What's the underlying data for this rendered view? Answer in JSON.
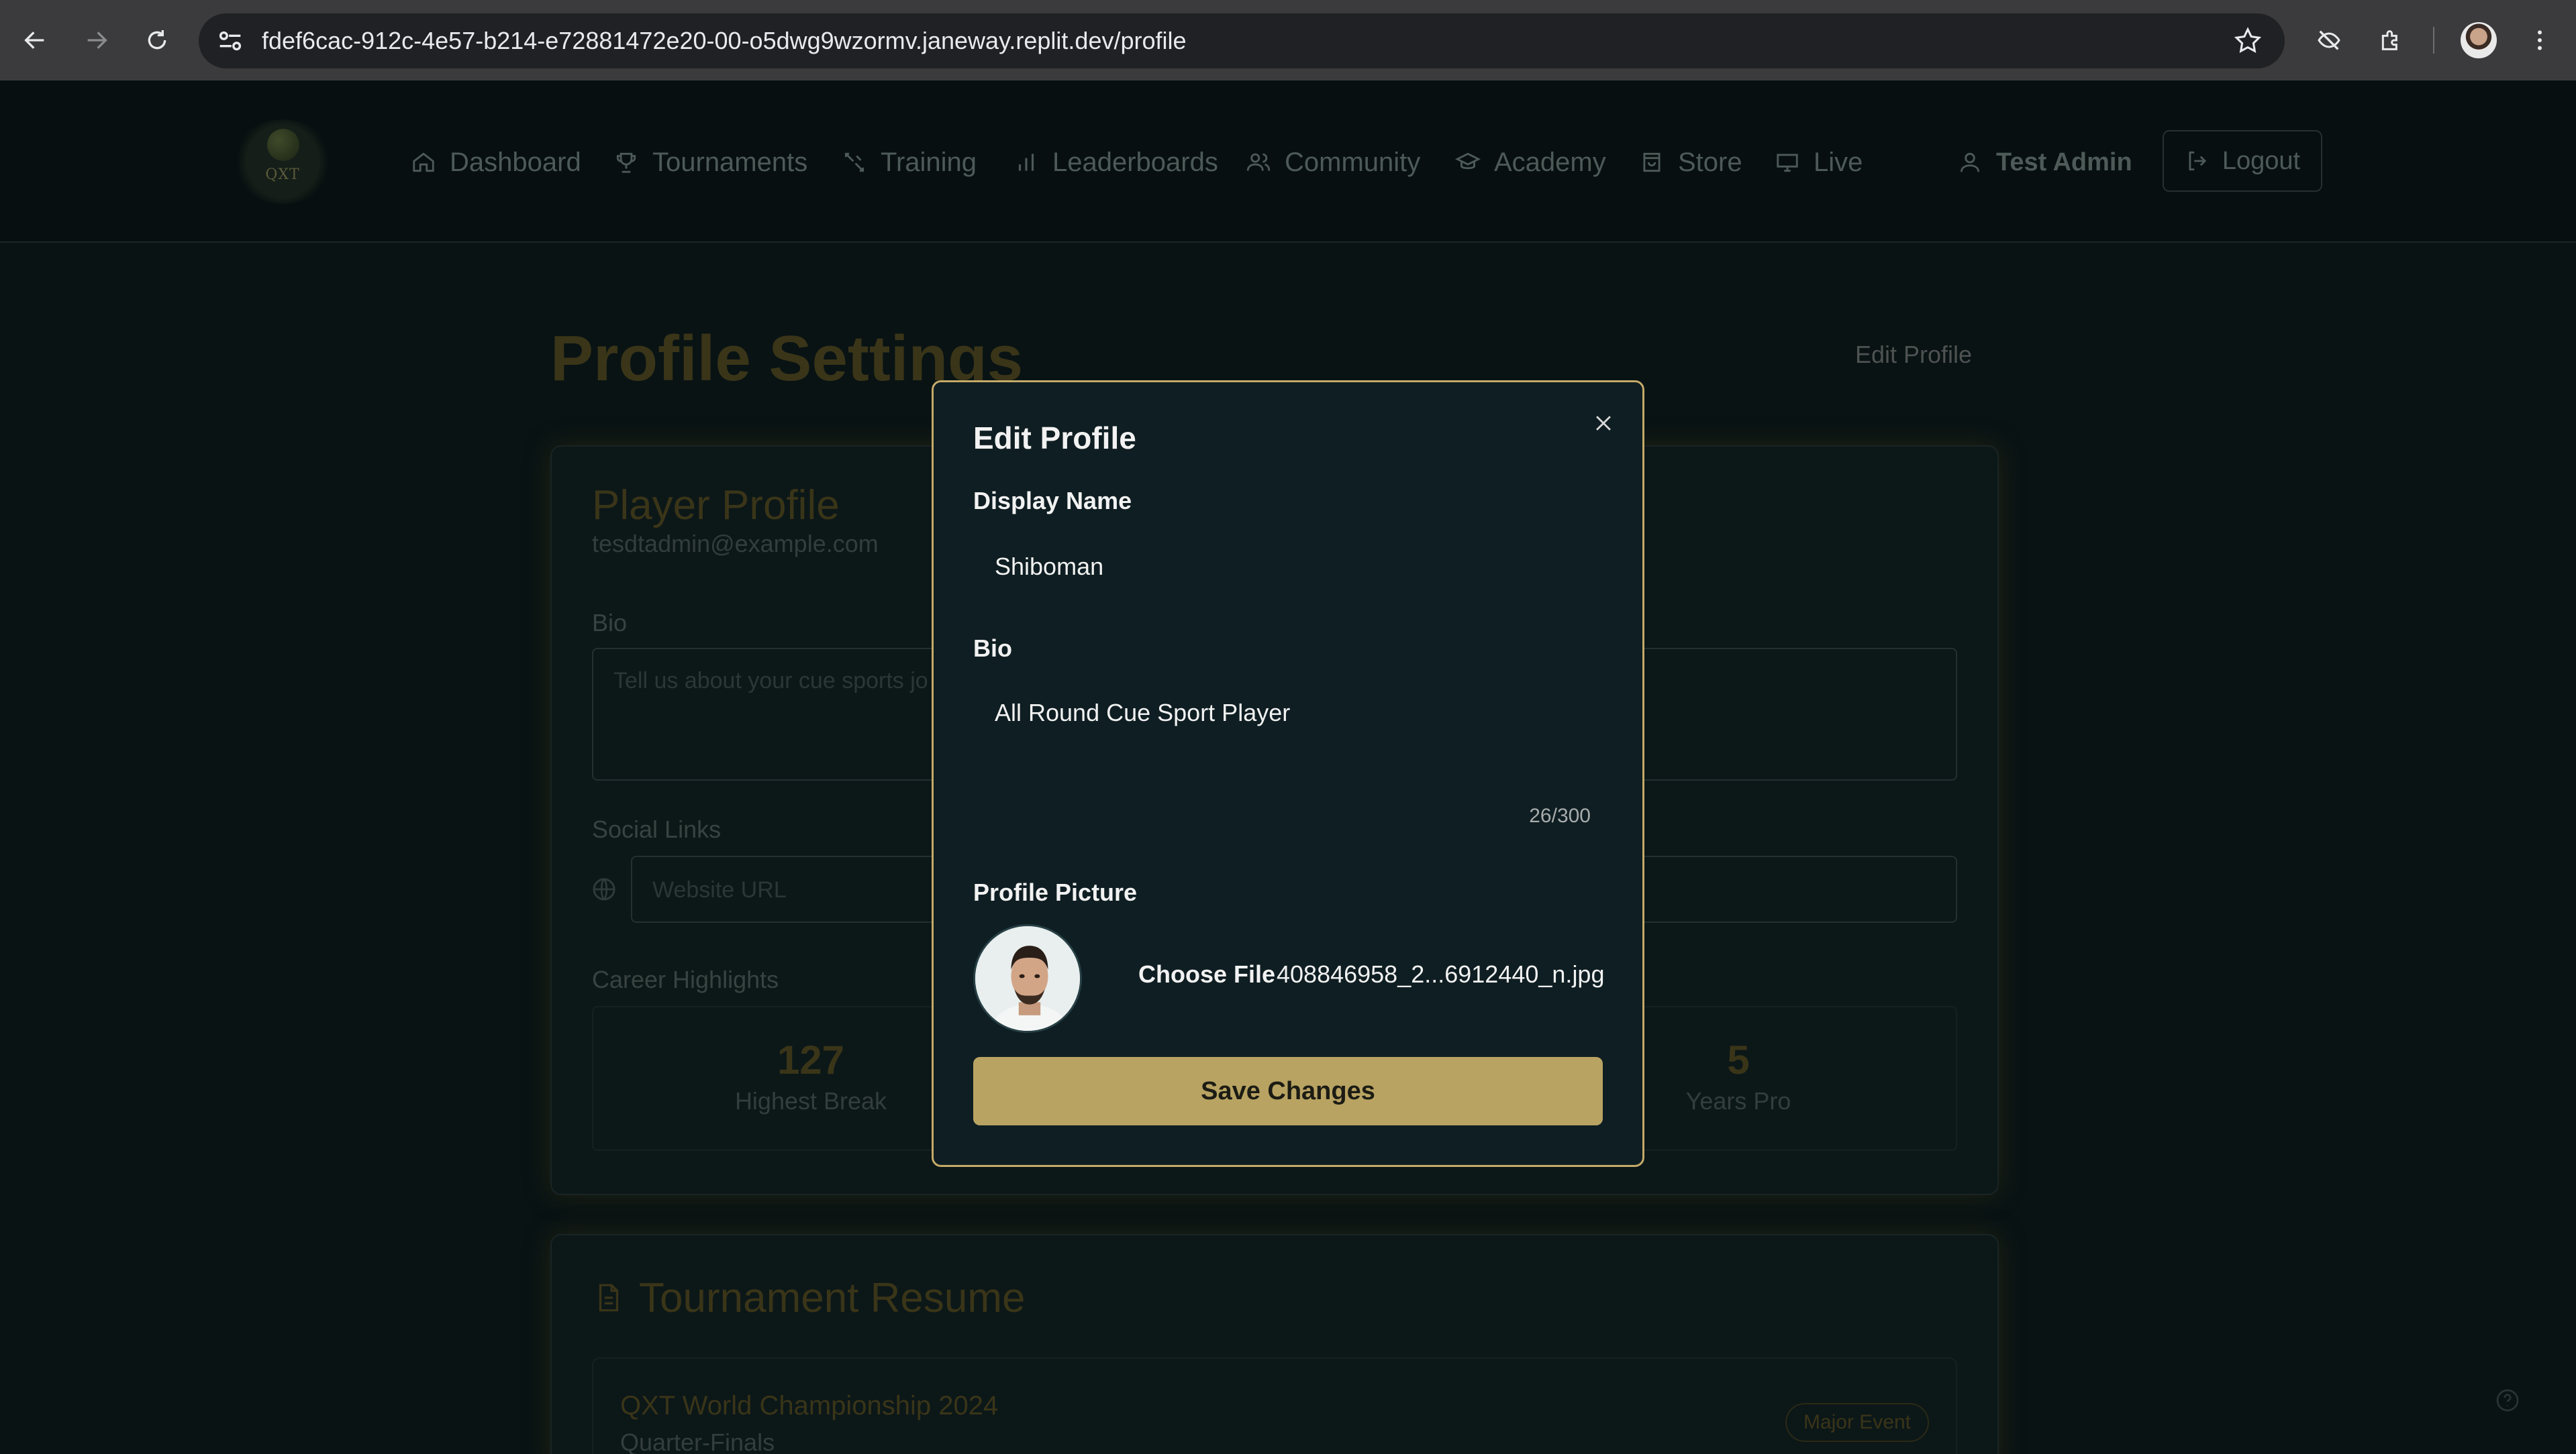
{
  "browser": {
    "url_host": "fdef6cac-912c-4e57-b214-e72881472e20-00-o5dwg9wzormv.janeway.replit.dev",
    "url_path": "/profile"
  },
  "header": {
    "logo_text": "QXT",
    "nav": [
      {
        "label": "Dashboard",
        "icon": "home-icon"
      },
      {
        "label": "Tournaments",
        "icon": "trophy-icon"
      },
      {
        "label": "Training",
        "icon": "training-icon"
      },
      {
        "label": "Leaderboards",
        "icon": "bar-chart-icon"
      },
      {
        "label": "Community",
        "icon": "users-icon"
      },
      {
        "label": "Academy",
        "icon": "graduation-cap-icon"
      },
      {
        "label": "Store",
        "icon": "store-icon"
      },
      {
        "label": "Live",
        "icon": "monitor-icon"
      }
    ],
    "user_name": "Test Admin",
    "logout_label": "Logout"
  },
  "page": {
    "title": "Profile Settings",
    "edit_profile_link": "Edit Profile",
    "player_card": {
      "title": "Player Profile",
      "email": "tesdtadmin@example.com",
      "bio_label": "Bio",
      "bio_placeholder": "Tell us about your cue sports jo",
      "social_label": "Social Links",
      "website_placeholder": "Website URL",
      "career_label": "Career Highlights",
      "stats": [
        {
          "value": "127",
          "label": "Highest Break"
        },
        {
          "value": "5",
          "label": "Years Pro"
        }
      ]
    },
    "resume": {
      "title": "Tournament Resume",
      "event": "QXT World Championship 2024",
      "result": "Quarter-Finals",
      "badge": "Major Event"
    }
  },
  "modal": {
    "title": "Edit Profile",
    "display_name_label": "Display Name",
    "display_name_value": "Shiboman",
    "bio_label": "Bio",
    "bio_value": "All Round Cue Sport Player",
    "bio_counter": "26/300",
    "picture_label": "Profile Picture",
    "choose_file_label": "Choose File",
    "file_name": "408846958_2...6912440_n.jpg",
    "save_label": "Save Changes"
  },
  "colors": {
    "accent_gold": "#b8a362",
    "modal_border": "#c4aa68",
    "background": "#091314",
    "modal_background": "#0f1e22"
  }
}
